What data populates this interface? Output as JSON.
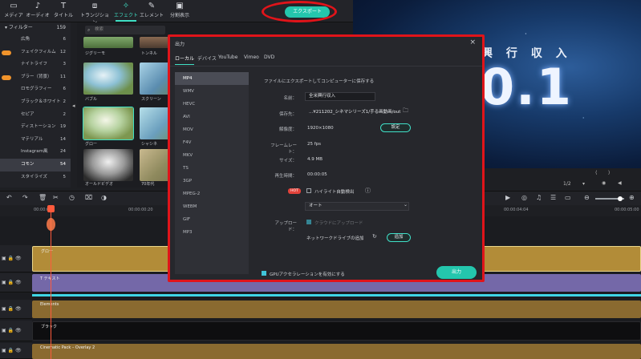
{
  "toolbar": {
    "items": [
      {
        "label": "メディア",
        "icon": "folder-icon"
      },
      {
        "label": "オーディオ",
        "icon": "music-icon"
      },
      {
        "label": "タイトル",
        "icon": "text-icon"
      },
      {
        "label": "トランジション",
        "icon": "transition-icon"
      },
      {
        "label": "エフェクト",
        "icon": "effects-icon"
      },
      {
        "label": "エレメント",
        "icon": "element-icon"
      },
      {
        "label": "分割表示",
        "icon": "split-icon"
      }
    ],
    "export_label": "エクスポート"
  },
  "sidebar": {
    "header": {
      "label": "フィルター",
      "count": "159"
    },
    "items": [
      {
        "label": "広角",
        "count": "6"
      },
      {
        "label": "フェイクフィルム",
        "count": "12"
      },
      {
        "label": "ナイトライフ",
        "count": "3"
      },
      {
        "label": "ブラー（背景）",
        "count": "11"
      },
      {
        "label": "ロモグラフィー",
        "count": "6"
      },
      {
        "label": "ブラック＆ホワイト",
        "count": "2"
      },
      {
        "label": "セピア",
        "count": "2"
      },
      {
        "label": "ディストーション",
        "count": "19"
      },
      {
        "label": "マテリアル",
        "count": "14"
      },
      {
        "label": "Instagram風",
        "count": "24"
      },
      {
        "label": "コモン",
        "count": "54"
      },
      {
        "label": "スタイライズ",
        "count": "5"
      }
    ]
  },
  "search": {
    "placeholder": "検索"
  },
  "thumbnails": [
    {
      "label": "ジグリーモ"
    },
    {
      "label": "トンネル"
    },
    {
      "label": "バブル"
    },
    {
      "label": "スクリーン"
    },
    {
      "label": "グロー"
    },
    {
      "label": "シャシネ"
    },
    {
      "label": "オールドビデオ"
    },
    {
      "label": "70年代"
    }
  ],
  "preview": {
    "title_text": "興 行 収 入",
    "big_text": "0.1",
    "zoom": "1/2"
  },
  "ruler": {
    "ticks": [
      "00:00:00",
      "00:00:00:20",
      "00:00:04:04",
      "00:00:05:00"
    ]
  },
  "tracks": [
    {
      "label": "グロー",
      "icon": "video-track-icon"
    },
    {
      "label": "T テキスト",
      "icon": "text-track-icon"
    },
    {
      "label": "Elements",
      "icon": "image-track-icon"
    },
    {
      "label": "ブラック",
      "icon": "image-track-icon"
    },
    {
      "label": "Cinematic Pack – Overlay 2",
      "icon": "image-track-icon"
    }
  ],
  "modal": {
    "title": "出力",
    "tabs": [
      "ローカル",
      "デバイス",
      "YouTube",
      "Vimeo",
      "DVD"
    ],
    "formats": [
      "MP4",
      "WMV",
      "HEVC",
      "AVI",
      "MOV",
      "F4V",
      "MKV",
      "TS",
      "3GP",
      "MPEG-2",
      "WEBM",
      "GIF",
      "MP3"
    ],
    "heading": "ファイルにエクスポートしてコンピューターに保存する",
    "fields": {
      "name_label": "名前：",
      "name_value": "全米興行収入",
      "save_label": "保存先：",
      "save_value": "...¥211202_シネマシリーズ1/手る画動画/out",
      "resolution_label": "解像度：",
      "resolution_value": "1920×1080",
      "settings_button": "設定",
      "framerate_label": "フレームレート：",
      "framerate_value": "25 fps",
      "size_label": "サイズ：",
      "size_value": "4.9 MB",
      "duration_label": "再生時間：",
      "duration_value": "00:00:05",
      "hot_badge": "HOT",
      "highlight_label": "ハイライト自動検出",
      "auto_option": "オート",
      "upload_label": "アップロード：",
      "cloud_label": "クラウドにアップロード",
      "network_label": "ネットワークドライブの追加",
      "add_button": "追加",
      "gpu_label": "GPUアクセラレーションを有効にする",
      "export_button": "出力"
    }
  }
}
